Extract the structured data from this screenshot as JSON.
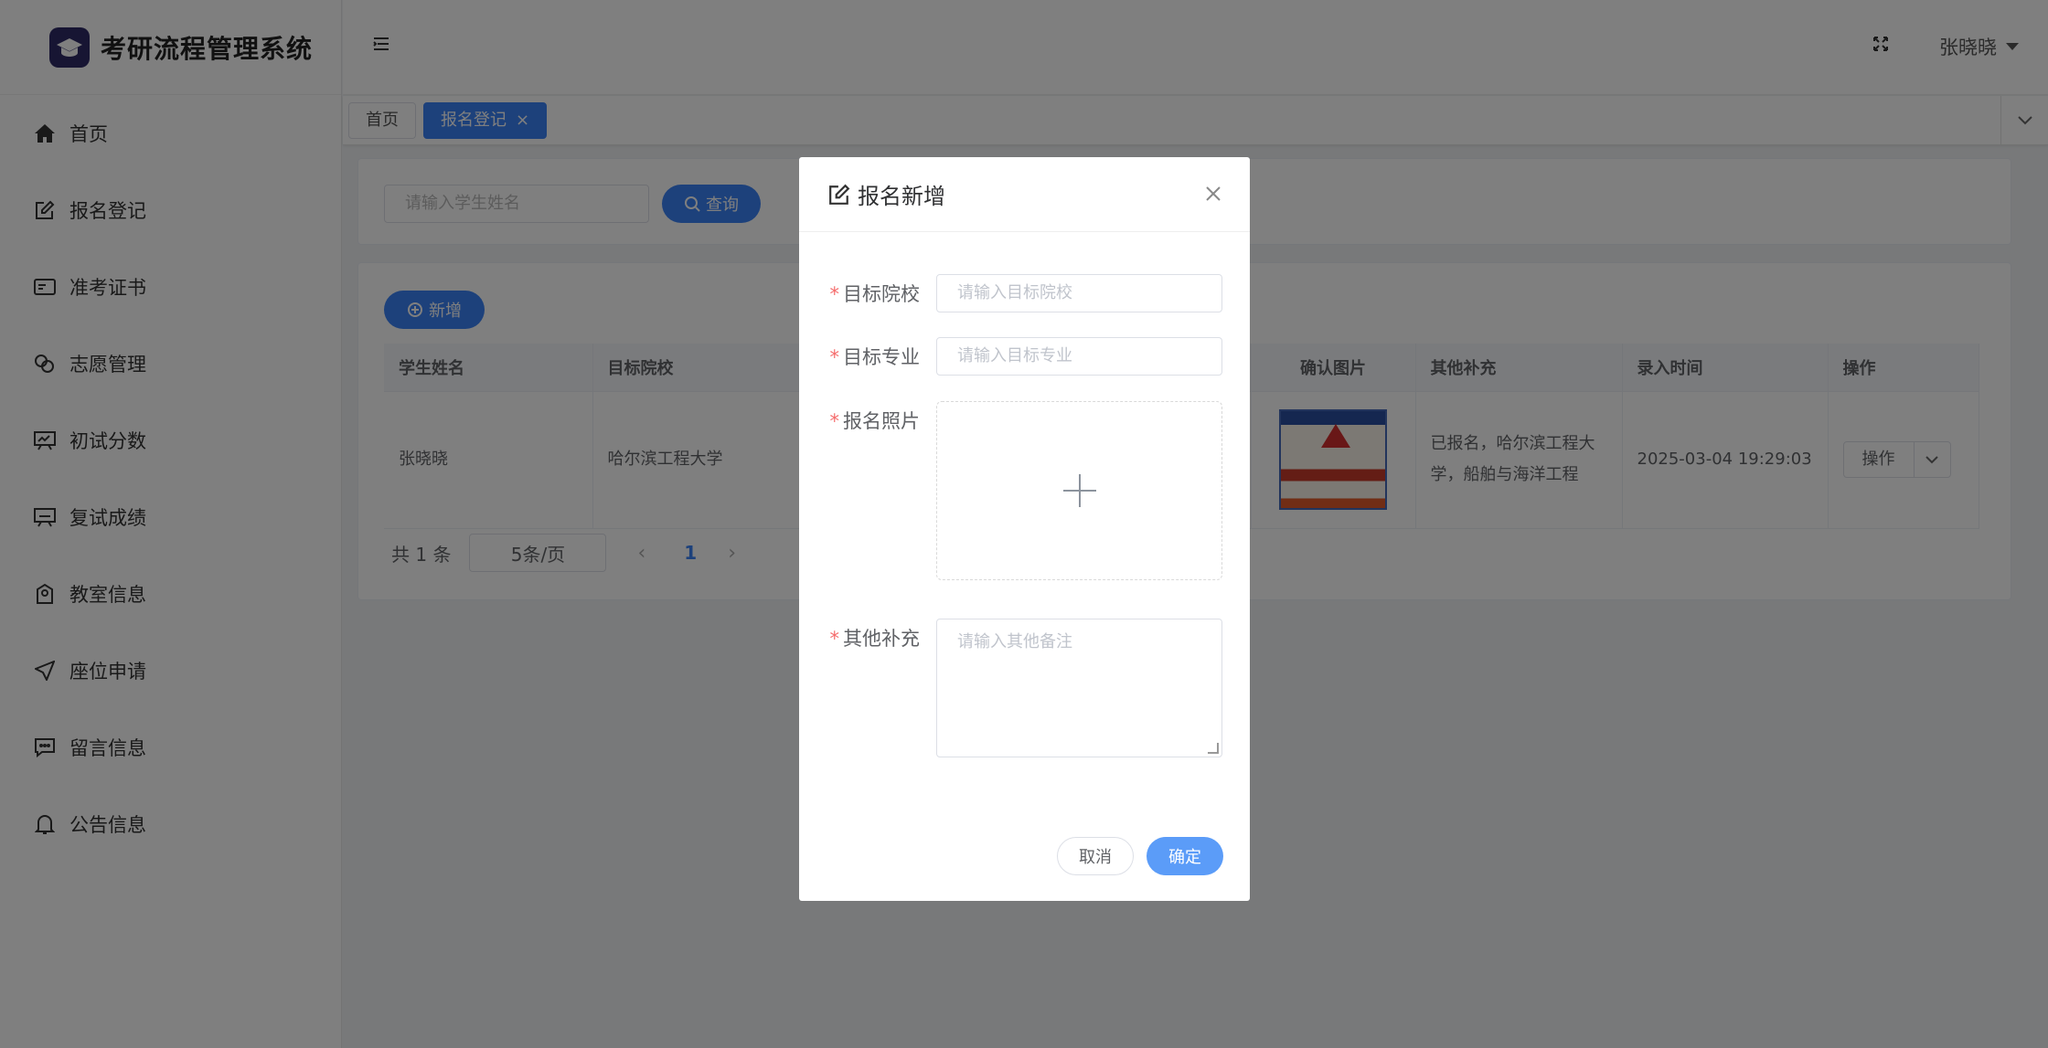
{
  "app": {
    "title": "考研流程管理系统",
    "user_name": "张晓晓"
  },
  "sidebar": {
    "items": [
      {
        "label": "首页",
        "icon": "home-icon"
      },
      {
        "label": "报名登记",
        "icon": "edit-icon"
      },
      {
        "label": "准考证书",
        "icon": "id-card-icon"
      },
      {
        "label": "志愿管理",
        "icon": "link-icon"
      },
      {
        "label": "初试分数",
        "icon": "chart-board-icon"
      },
      {
        "label": "复试成绩",
        "icon": "board-icon"
      },
      {
        "label": "教室信息",
        "icon": "building-icon"
      },
      {
        "label": "座位申请",
        "icon": "send-icon"
      },
      {
        "label": "留言信息",
        "icon": "message-icon"
      },
      {
        "label": "公告信息",
        "icon": "bell-icon"
      }
    ]
  },
  "tags": [
    {
      "label": "首页"
    },
    {
      "label": "报名登记",
      "close": "×"
    }
  ],
  "search": {
    "placeholder": "请输入学生姓名",
    "button": "查询"
  },
  "toolbar": {
    "add_label": "新增"
  },
  "table": {
    "columns": [
      "学生姓名",
      "目标院校",
      "确认图片",
      "其他补充",
      "录入时间",
      "操作"
    ],
    "rows": [
      {
        "student": "张晓晓",
        "school": "哈尔滨工程大学",
        "note": "已报名，哈尔滨工程大学，船舶与海洋工程",
        "time": "2025-03-04 19:29:03",
        "op": "操作"
      }
    ]
  },
  "pagination": {
    "total": "共 1 条",
    "page_size": "5条/页",
    "current": "1"
  },
  "dialog": {
    "title": "报名新增",
    "fields": {
      "school": {
        "label": "目标院校",
        "placeholder": "请输入目标院校"
      },
      "major": {
        "label": "目标专业",
        "placeholder": "请输入目标专业"
      },
      "photo": {
        "label": "报名照片"
      },
      "note": {
        "label": "其他补充",
        "placeholder": "请输入其他备注"
      }
    },
    "required_mark": "*",
    "cancel": "取消",
    "confirm": "确定"
  },
  "colors": {
    "primary": "#3b82f6",
    "required": "#f56c6c",
    "overlay": "rgba(0,0,0,0.5)"
  }
}
